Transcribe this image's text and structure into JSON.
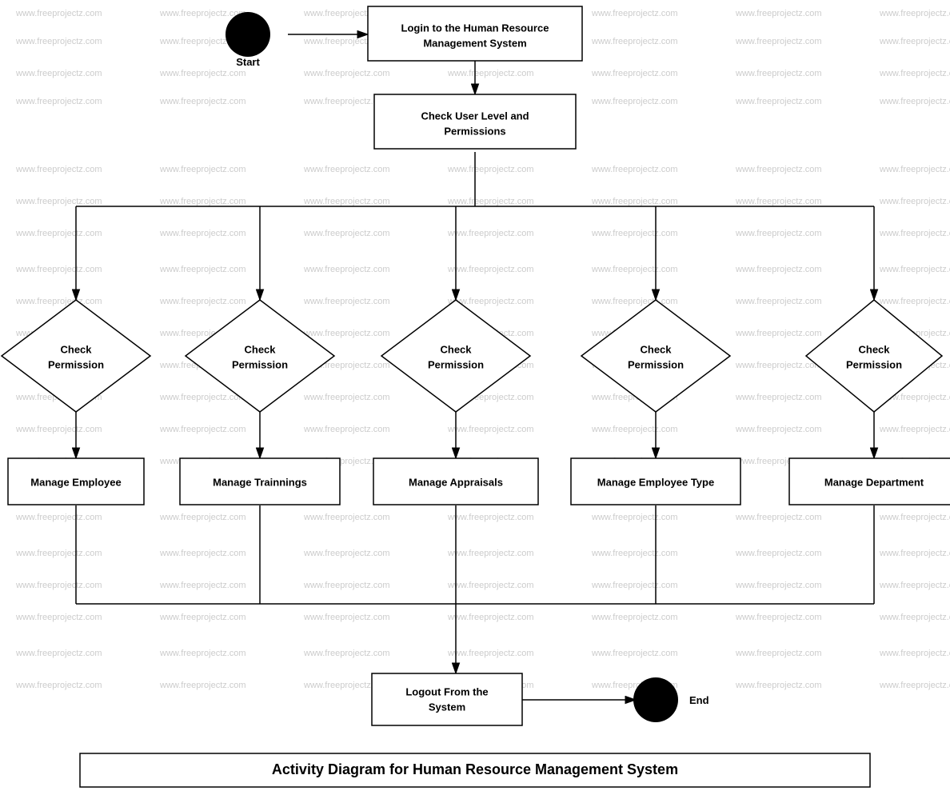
{
  "diagram": {
    "title": "Activity Diagram for Human Resource Management System",
    "nodes": {
      "start": {
        "label": "Start",
        "type": "circle"
      },
      "login": {
        "label": "Login to the Human Resource\nManagement System",
        "type": "rect"
      },
      "checkUserLevel": {
        "label": "Check User Level and\nPermissions",
        "type": "rect"
      },
      "checkPerm1": {
        "label": "Check\nPermission",
        "type": "diamond"
      },
      "checkPerm2": {
        "label": "Check\nPermission",
        "type": "diamond"
      },
      "checkPerm3": {
        "label": "Check\nPermission",
        "type": "diamond"
      },
      "checkPerm4": {
        "label": "Check\nPermission",
        "type": "diamond"
      },
      "checkPerm5": {
        "label": "Check\nPermission",
        "type": "diamond"
      },
      "manageEmployee": {
        "label": "Manage Employee",
        "type": "rect"
      },
      "manageTrainings": {
        "label": "Manage Trainnings",
        "type": "rect"
      },
      "manageAppraisals": {
        "label": "Manage Appraisals",
        "type": "rect"
      },
      "manageEmployeeType": {
        "label": "Manage Employee Type",
        "type": "rect"
      },
      "manageDepartment": {
        "label": "Manage Department",
        "type": "rect"
      },
      "logout": {
        "label": "Logout From the\nSystem",
        "type": "rect"
      },
      "end": {
        "label": "End",
        "type": "circle"
      }
    },
    "watermark": "www.freeprojectz.com"
  }
}
